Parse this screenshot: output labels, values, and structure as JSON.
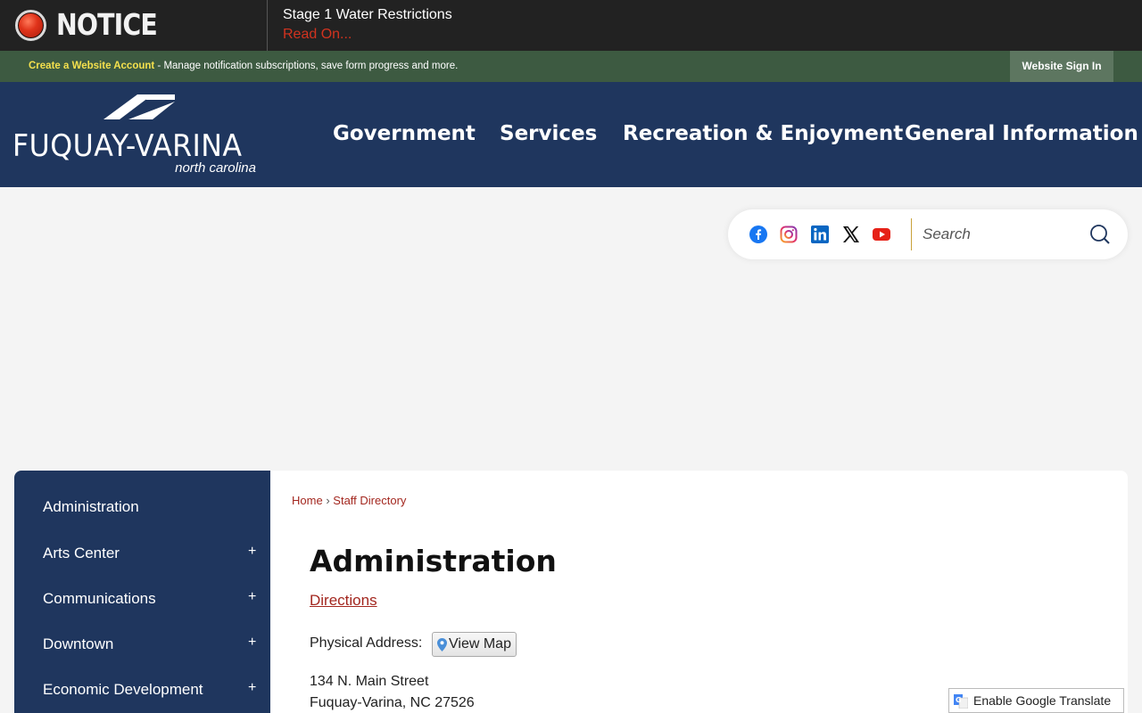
{
  "notice": {
    "label": "NOTICE",
    "title": "Stage 1 Water Restrictions",
    "link": "Read On..."
  },
  "account_bar": {
    "create_link": "Create a Website Account",
    "description": " - Manage notification subscriptions, save form progress and more.",
    "signin_label": "Website Sign In"
  },
  "logo": {
    "main": "FUQUAY-VARINA",
    "sub": "north carolina"
  },
  "nav": {
    "items": [
      {
        "label": "Government"
      },
      {
        "label": "Services"
      },
      {
        "label": "Recreation & Enjoyment"
      },
      {
        "label": "General Information"
      }
    ]
  },
  "social": {
    "icons": [
      "facebook-icon",
      "instagram-icon",
      "linkedin-icon",
      "x-icon",
      "youtube-icon"
    ]
  },
  "search": {
    "placeholder": "Search",
    "value": ""
  },
  "sidebar": {
    "items": [
      {
        "label": "Administration",
        "expandable": false
      },
      {
        "label": "Arts Center",
        "expandable": true
      },
      {
        "label": "Communications",
        "expandable": true
      },
      {
        "label": "Downtown",
        "expandable": true
      },
      {
        "label": "Economic Development",
        "expandable": true
      }
    ],
    "plus_symbol": "+"
  },
  "breadcrumb": {
    "home": "Home",
    "separator": "›",
    "current": "Staff Directory"
  },
  "content": {
    "title": "Administration",
    "directions": "Directions",
    "physical_label": "Physical Address:",
    "view_map": "View Map",
    "address_line1": "134 N. Main Street",
    "address_line2": "Fuquay-Varina, NC 27526"
  },
  "translate": {
    "label": "Enable Google Translate"
  },
  "colors": {
    "navy": "#1f365e",
    "green_bar": "#3d5a41",
    "notice_red": "#d1331f",
    "link_red": "#a3271f",
    "account_yellow": "#f4e04d"
  }
}
